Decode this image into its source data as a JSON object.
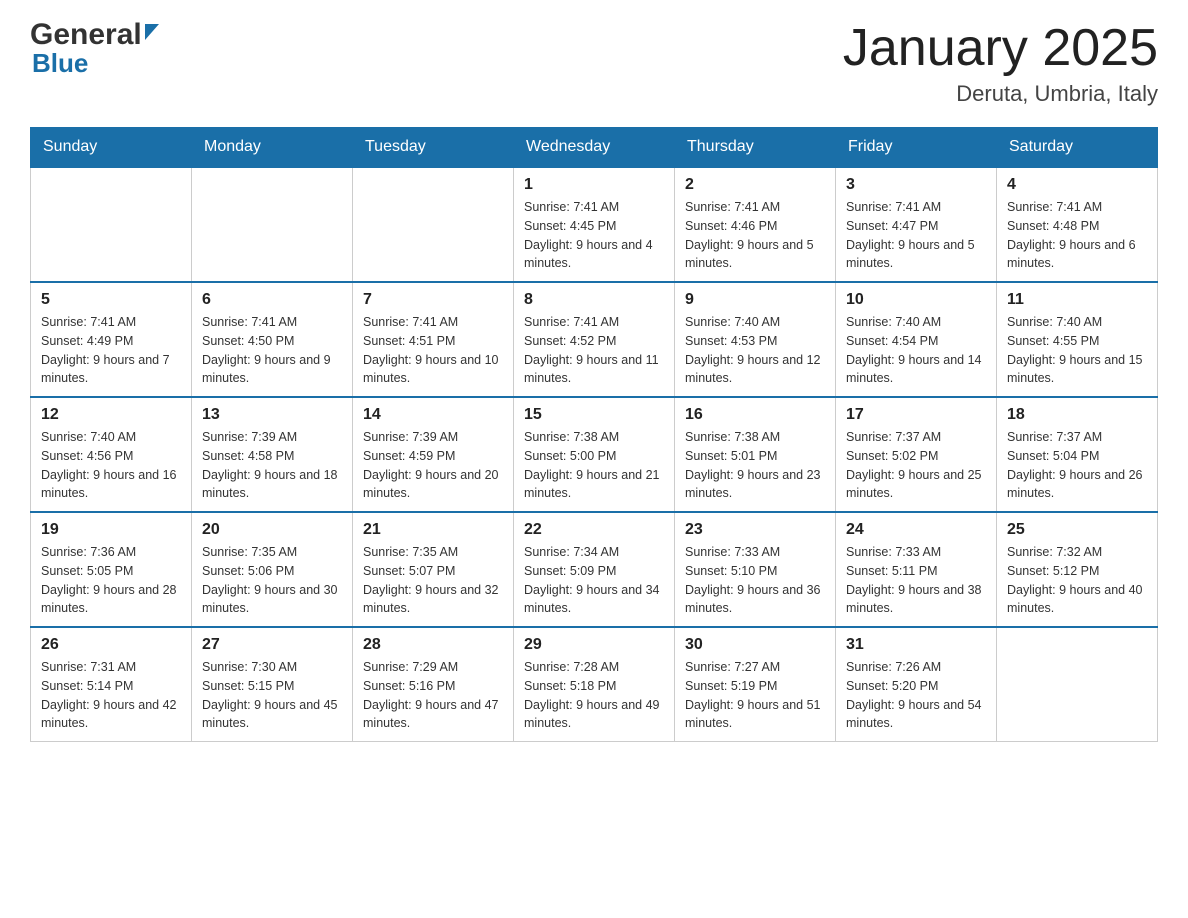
{
  "header": {
    "logo_general": "General",
    "logo_blue": "Blue",
    "month_title": "January 2025",
    "location": "Deruta, Umbria, Italy"
  },
  "weekdays": [
    "Sunday",
    "Monday",
    "Tuesday",
    "Wednesday",
    "Thursday",
    "Friday",
    "Saturday"
  ],
  "weeks": [
    [
      {
        "day": "",
        "info": ""
      },
      {
        "day": "",
        "info": ""
      },
      {
        "day": "",
        "info": ""
      },
      {
        "day": "1",
        "info": "Sunrise: 7:41 AM\nSunset: 4:45 PM\nDaylight: 9 hours\nand 4 minutes."
      },
      {
        "day": "2",
        "info": "Sunrise: 7:41 AM\nSunset: 4:46 PM\nDaylight: 9 hours\nand 5 minutes."
      },
      {
        "day": "3",
        "info": "Sunrise: 7:41 AM\nSunset: 4:47 PM\nDaylight: 9 hours\nand 5 minutes."
      },
      {
        "day": "4",
        "info": "Sunrise: 7:41 AM\nSunset: 4:48 PM\nDaylight: 9 hours\nand 6 minutes."
      }
    ],
    [
      {
        "day": "5",
        "info": "Sunrise: 7:41 AM\nSunset: 4:49 PM\nDaylight: 9 hours\nand 7 minutes."
      },
      {
        "day": "6",
        "info": "Sunrise: 7:41 AM\nSunset: 4:50 PM\nDaylight: 9 hours\nand 9 minutes."
      },
      {
        "day": "7",
        "info": "Sunrise: 7:41 AM\nSunset: 4:51 PM\nDaylight: 9 hours\nand 10 minutes."
      },
      {
        "day": "8",
        "info": "Sunrise: 7:41 AM\nSunset: 4:52 PM\nDaylight: 9 hours\nand 11 minutes."
      },
      {
        "day": "9",
        "info": "Sunrise: 7:40 AM\nSunset: 4:53 PM\nDaylight: 9 hours\nand 12 minutes."
      },
      {
        "day": "10",
        "info": "Sunrise: 7:40 AM\nSunset: 4:54 PM\nDaylight: 9 hours\nand 14 minutes."
      },
      {
        "day": "11",
        "info": "Sunrise: 7:40 AM\nSunset: 4:55 PM\nDaylight: 9 hours\nand 15 minutes."
      }
    ],
    [
      {
        "day": "12",
        "info": "Sunrise: 7:40 AM\nSunset: 4:56 PM\nDaylight: 9 hours\nand 16 minutes."
      },
      {
        "day": "13",
        "info": "Sunrise: 7:39 AM\nSunset: 4:58 PM\nDaylight: 9 hours\nand 18 minutes."
      },
      {
        "day": "14",
        "info": "Sunrise: 7:39 AM\nSunset: 4:59 PM\nDaylight: 9 hours\nand 20 minutes."
      },
      {
        "day": "15",
        "info": "Sunrise: 7:38 AM\nSunset: 5:00 PM\nDaylight: 9 hours\nand 21 minutes."
      },
      {
        "day": "16",
        "info": "Sunrise: 7:38 AM\nSunset: 5:01 PM\nDaylight: 9 hours\nand 23 minutes."
      },
      {
        "day": "17",
        "info": "Sunrise: 7:37 AM\nSunset: 5:02 PM\nDaylight: 9 hours\nand 25 minutes."
      },
      {
        "day": "18",
        "info": "Sunrise: 7:37 AM\nSunset: 5:04 PM\nDaylight: 9 hours\nand 26 minutes."
      }
    ],
    [
      {
        "day": "19",
        "info": "Sunrise: 7:36 AM\nSunset: 5:05 PM\nDaylight: 9 hours\nand 28 minutes."
      },
      {
        "day": "20",
        "info": "Sunrise: 7:35 AM\nSunset: 5:06 PM\nDaylight: 9 hours\nand 30 minutes."
      },
      {
        "day": "21",
        "info": "Sunrise: 7:35 AM\nSunset: 5:07 PM\nDaylight: 9 hours\nand 32 minutes."
      },
      {
        "day": "22",
        "info": "Sunrise: 7:34 AM\nSunset: 5:09 PM\nDaylight: 9 hours\nand 34 minutes."
      },
      {
        "day": "23",
        "info": "Sunrise: 7:33 AM\nSunset: 5:10 PM\nDaylight: 9 hours\nand 36 minutes."
      },
      {
        "day": "24",
        "info": "Sunrise: 7:33 AM\nSunset: 5:11 PM\nDaylight: 9 hours\nand 38 minutes."
      },
      {
        "day": "25",
        "info": "Sunrise: 7:32 AM\nSunset: 5:12 PM\nDaylight: 9 hours\nand 40 minutes."
      }
    ],
    [
      {
        "day": "26",
        "info": "Sunrise: 7:31 AM\nSunset: 5:14 PM\nDaylight: 9 hours\nand 42 minutes."
      },
      {
        "day": "27",
        "info": "Sunrise: 7:30 AM\nSunset: 5:15 PM\nDaylight: 9 hours\nand 45 minutes."
      },
      {
        "day": "28",
        "info": "Sunrise: 7:29 AM\nSunset: 5:16 PM\nDaylight: 9 hours\nand 47 minutes."
      },
      {
        "day": "29",
        "info": "Sunrise: 7:28 AM\nSunset: 5:18 PM\nDaylight: 9 hours\nand 49 minutes."
      },
      {
        "day": "30",
        "info": "Sunrise: 7:27 AM\nSunset: 5:19 PM\nDaylight: 9 hours\nand 51 minutes."
      },
      {
        "day": "31",
        "info": "Sunrise: 7:26 AM\nSunset: 5:20 PM\nDaylight: 9 hours\nand 54 minutes."
      },
      {
        "day": "",
        "info": ""
      }
    ]
  ],
  "colors": {
    "header_bg": "#1a6fa8",
    "header_text": "#ffffff",
    "border": "#cccccc",
    "day_num": "#222222",
    "day_info": "#333333"
  }
}
